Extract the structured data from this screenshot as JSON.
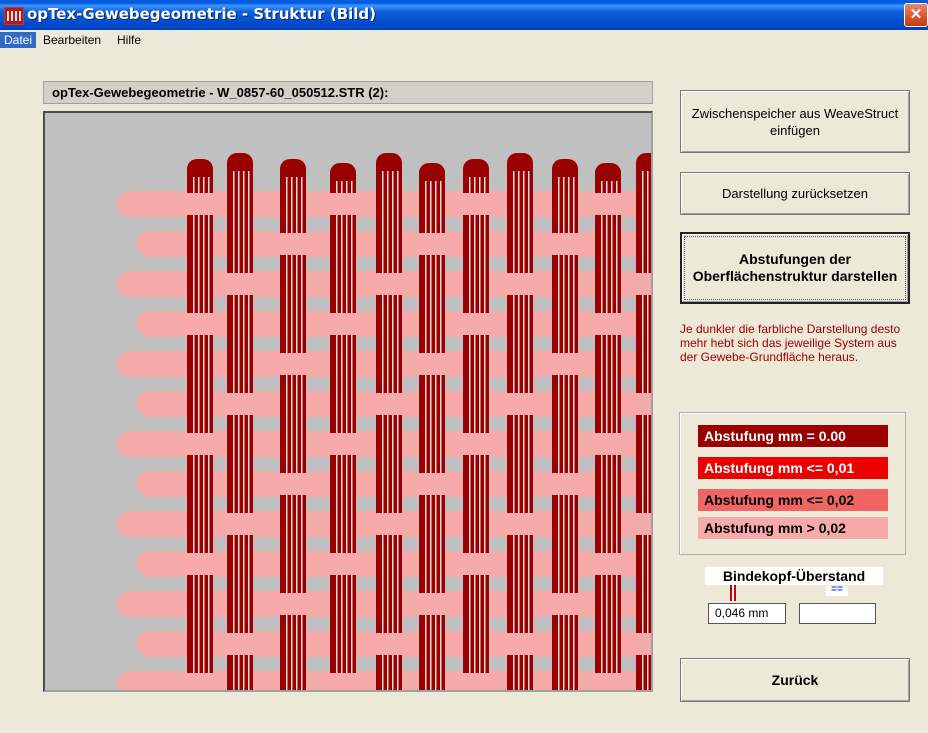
{
  "window": {
    "title": "opTex-Gewebegeometrie - Struktur (Bild)",
    "close_glyph": "✕"
  },
  "menu": [
    "Datei",
    "Bearbeiten",
    "Hilfe"
  ],
  "header": "opTex-Gewebegeometrie - W_0857-60_050512.STR (2):",
  "buttons": {
    "insert": "Zwischenspeicher aus WeaveStruct einfügen",
    "reset": "Darstellung zurücksetzen",
    "gradation": "Abstufungen der Oberflächenstruktur darstellen",
    "back": "Zurück"
  },
  "info_text": "Je dunkler die farbliche Darstellung desto mehr hebt sich das jeweilige System aus der Gewebe-Grundfläche heraus.",
  "legend": [
    {
      "label": "Abstufung mm  =  0.00",
      "bg": "#990000",
      "fg": "#ffffff"
    },
    {
      "label": "Abstufung mm <= 0,01",
      "bg": "#ee0000",
      "fg": "#ffffff"
    },
    {
      "label": "Abstufung mm <= 0,02",
      "bg": "#f26565",
      "fg": "#000000"
    },
    {
      "label": "Abstufung mm  >  0,02",
      "bg": "#f6aaaa",
      "fg": "#000000"
    }
  ],
  "bindekopf": {
    "title": "Bindekopf-Überstand",
    "value_left": "0,046 mm",
    "value_right": "",
    "mark_blue": "=="
  },
  "colors": {
    "warp_dark": "#990000",
    "weft_light": "#f6aaaa",
    "canvas_bg": "#c0c0c0",
    "stripe_white": "#ffffff"
  }
}
